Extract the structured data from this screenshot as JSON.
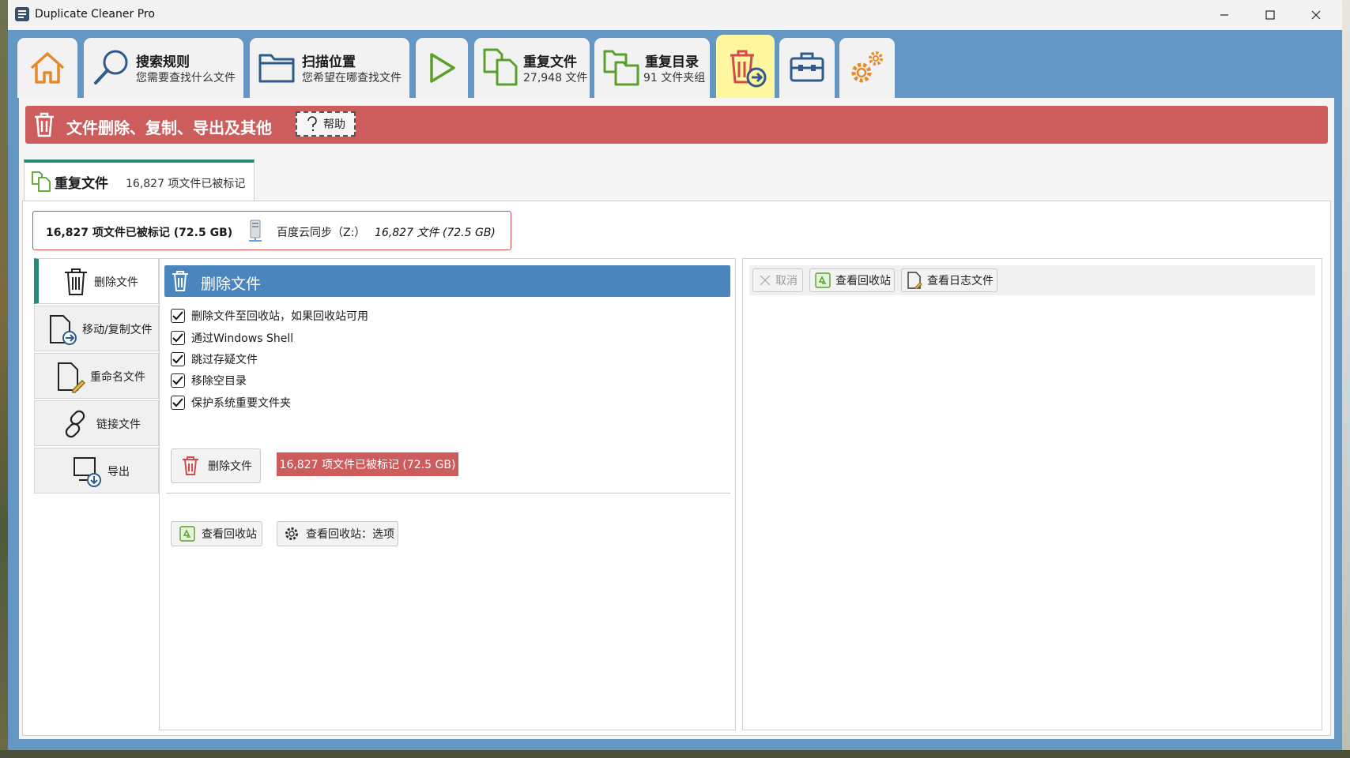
{
  "window": {
    "title": "Duplicate Cleaner Pro"
  },
  "top_tabs": {
    "search_rules": {
      "title": "搜索规则",
      "subtitle": "您需要查找什么文件"
    },
    "scan_location": {
      "title": "扫描位置",
      "subtitle": "您希望在哪查找文件"
    },
    "duplicate_files": {
      "title": "重复文件",
      "subtitle": "27,948 文件"
    },
    "duplicate_folders": {
      "title": "重复目录",
      "subtitle": "91 文件夹组"
    }
  },
  "banner": {
    "title": "文件删除、复制、导出及其他",
    "help_label": "帮助"
  },
  "subtab": {
    "title": "重复文件",
    "count": "16,827 项文件已被标记"
  },
  "summary": {
    "marked": "16,827 项文件已被标记 (72.5 GB)",
    "drive_label": "百度云同步（Z:）",
    "drive_count": "16,827 文件 (72.5 GB)"
  },
  "side_nav": [
    {
      "label": "删除文件"
    },
    {
      "label": "移动/复制文件"
    },
    {
      "label": "重命名文件"
    },
    {
      "label": "链接文件"
    },
    {
      "label": "导出"
    }
  ],
  "delete_section": {
    "title": "删除文件",
    "options": [
      {
        "label": "删除文件至回收站，如果回收站可用",
        "checked": true
      },
      {
        "label": "通过Windows Shell",
        "checked": true
      },
      {
        "label": "跳过存疑文件",
        "checked": true
      },
      {
        "label": "移除空目录",
        "checked": true
      },
      {
        "label": "保护系统重要文件夹",
        "checked": true
      }
    ],
    "delete_button": "删除文件",
    "marked_badge": "16,827 项文件已被标记 (72.5 GB)",
    "view_recycle": "查看回收站",
    "recycle_options": "查看回收站：选项"
  },
  "right_toolbar": {
    "cancel": "取消",
    "view_recycle": "查看回收站",
    "view_log": "查看日志文件"
  },
  "colors": {
    "window_frame": "#6497c3",
    "banner_red": "#cd5c5c",
    "section_blue": "#4a86bd",
    "accent_teal": "#2a8a7a",
    "active_tab": "#fff7a0",
    "icon_orange": "#e58a2a",
    "icon_green": "#5aa02c",
    "icon_blue": "#2f5a8c"
  }
}
